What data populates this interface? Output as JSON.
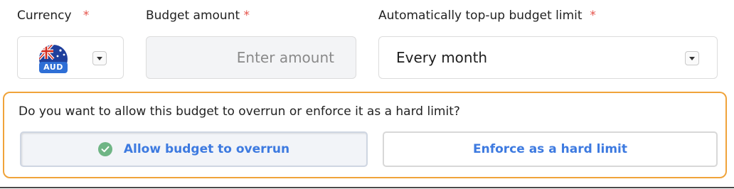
{
  "currency": {
    "label": "Currency",
    "required_mark": "*",
    "code": "AUD",
    "flag_icon": "australia-flag-icon"
  },
  "budget": {
    "label": "Budget amount",
    "required_mark": "*",
    "placeholder": "Enter amount",
    "value": ""
  },
  "topup": {
    "label": "Automatically top-up budget limit",
    "required_mark": "*",
    "selected": "Every month"
  },
  "overrun": {
    "question": "Do you want to allow this budget to overrun or enforce it as a hard limit?",
    "options": [
      {
        "label": "Allow budget to overrun",
        "selected": true
      },
      {
        "label": "Enforce as a hard limit",
        "selected": false
      }
    ]
  },
  "colors": {
    "accent": "#3d7ae0",
    "required": "#e5534b",
    "panel_border": "#f0a33a",
    "check": "#6fb585"
  }
}
